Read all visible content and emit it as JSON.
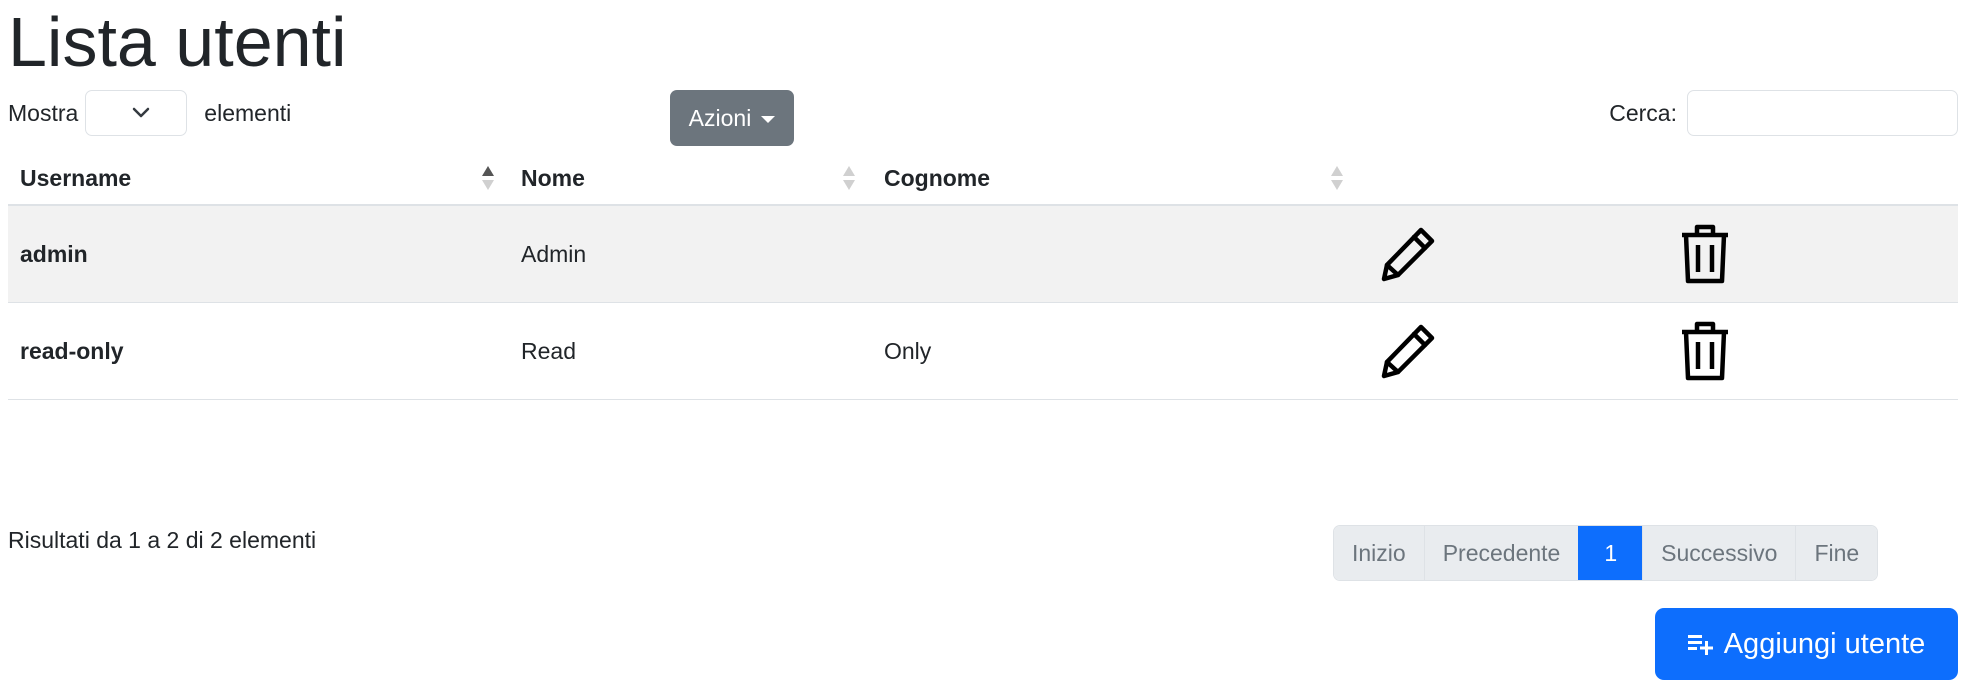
{
  "title": "Lista utenti",
  "length": {
    "prefix": "Mostra",
    "selected": "",
    "suffix": "elementi"
  },
  "actions": {
    "label": "Azioni"
  },
  "search": {
    "label": "Cerca:",
    "value": ""
  },
  "table": {
    "columns": [
      "Username",
      "Nome",
      "Cognome"
    ],
    "sort": {
      "column": "Username",
      "direction": "asc"
    },
    "rows": [
      {
        "username": "admin",
        "nome": "Admin",
        "cognome": ""
      },
      {
        "username": "read-only",
        "nome": "Read",
        "cognome": "Only"
      }
    ],
    "row_icons": [
      "pencil-icon",
      "trash-icon"
    ]
  },
  "info": "Risultati da 1 a 2 di 2 elementi",
  "pagination": {
    "first": "Inizio",
    "prev": "Precedente",
    "current": "1",
    "next": "Successivo",
    "last": "Fine"
  },
  "add_button": {
    "label": "Aggiungi utente",
    "icon": "playlist-add-icon"
  },
  "colors": {
    "primary": "#0d6efd",
    "secondary": "#6c757d",
    "stripe": "#f2f2f2"
  }
}
